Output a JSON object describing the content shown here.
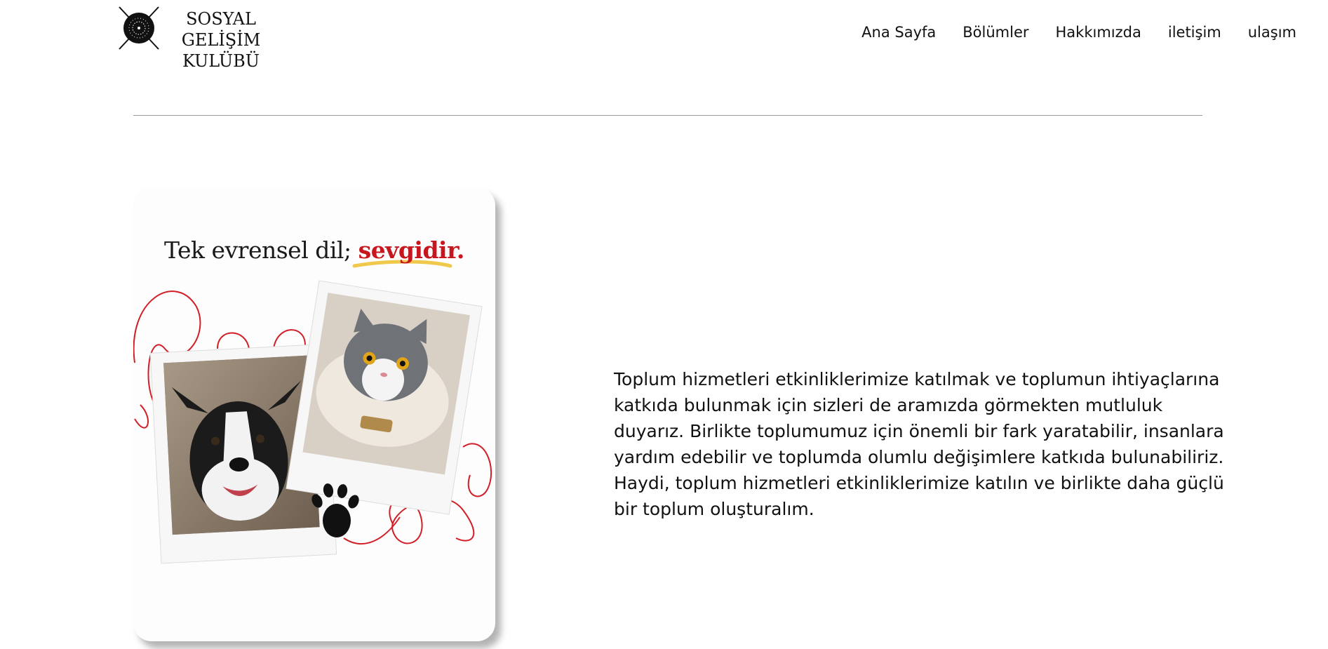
{
  "logo": {
    "line1": "SOSYAL GELİŞİM",
    "line2": "KULÜBÜ",
    "icon": "club-emblem-icon"
  },
  "nav": {
    "items": [
      {
        "label": "Ana Sayfa"
      },
      {
        "label": "Bölümler"
      },
      {
        "label": "Hakkımızda"
      },
      {
        "label": "iletişim"
      },
      {
        "label": "ulaşım"
      }
    ]
  },
  "card": {
    "title_main": "Tek evrensel dil;",
    "title_accent": "sevgidir.",
    "accent_color": "#c8161f",
    "images": [
      "dog-photo",
      "cat-photo",
      "paw-icon"
    ]
  },
  "content": {
    "paragraph": "Toplum hizmetleri etkinliklerimize katılmak ve toplumun ihtiyaçlarına katkıda bulunmak için sizleri de aramızda görmekten mutluluk duyarız. Birlikte toplumumuz için önemli bir fark yaratabilir, insanlara yardım edebilir ve toplumda olumlu değişimlere katkıda bulunabiliriz. Haydi, toplum hizmetleri etkinliklerimize katılın ve birlikte daha güçlü bir toplum oluşturalım."
  }
}
